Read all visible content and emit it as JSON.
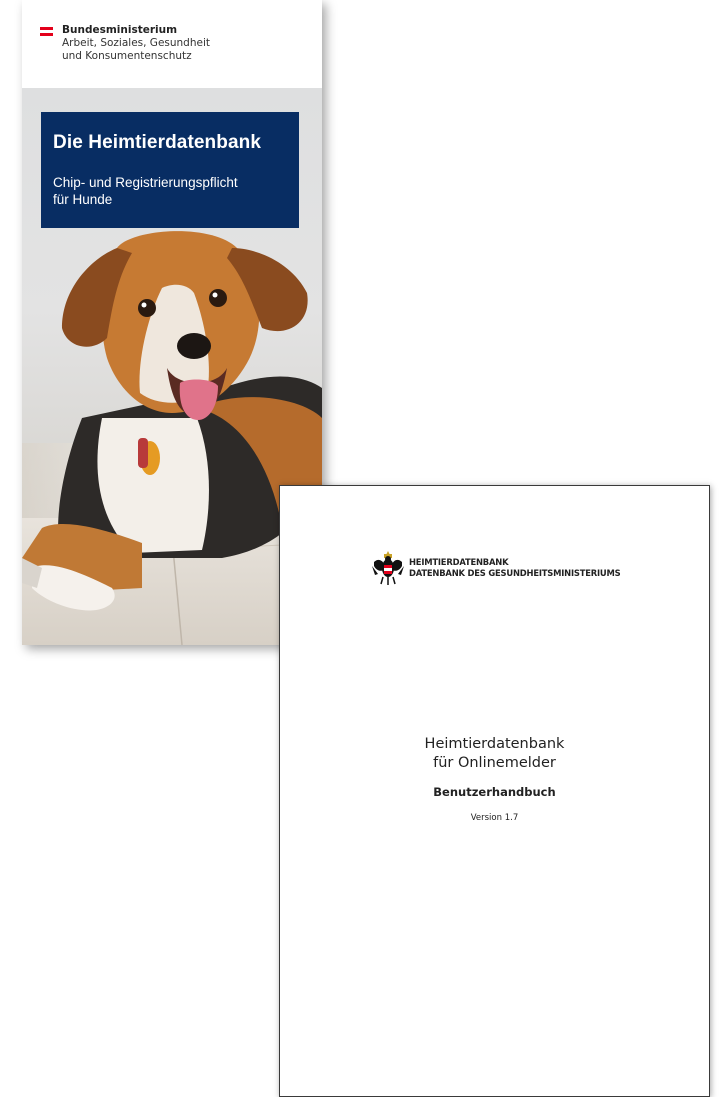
{
  "brochure": {
    "ministry_line1": "Bundesministerium",
    "ministry_line2": "Arbeit, Soziales, Gesundheit",
    "ministry_line3": "und Konsumentenschutz",
    "title": "Die Heimtierdatenbank",
    "subtitle_line1": "Chip- und Registrierungspflicht",
    "subtitle_line2": "für Hunde",
    "flag_colors": [
      "#e3001b",
      "#ffffff",
      "#e3001b"
    ],
    "title_box_color": "#082d63"
  },
  "manual": {
    "org_line1": "HEIMTIERDATENBANK",
    "org_line2": "DATENBANK DES GESUNDHEITSMINISTERIUMS",
    "title_line1": "Heimtierdatenbank",
    "title_line2": "für Onlinemelder",
    "subtitle": "Benutzerhandbuch",
    "version": "Version 1.7",
    "logo_icon": "eagle-coat-of-arms-icon"
  }
}
